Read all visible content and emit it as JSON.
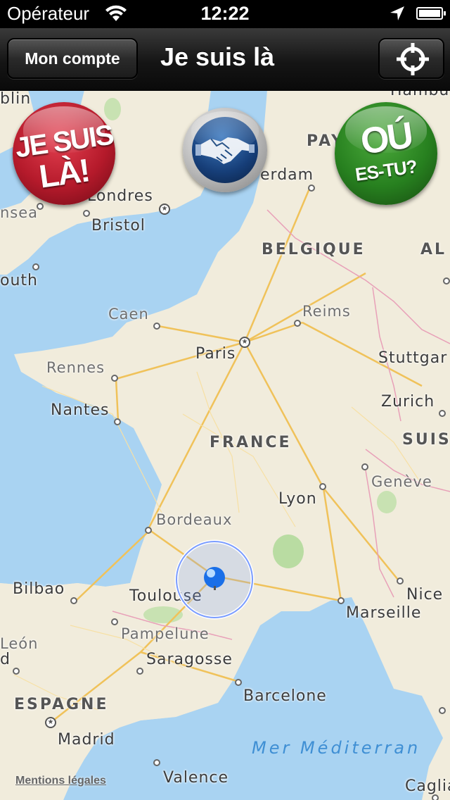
{
  "status_bar": {
    "carrier": "Opérateur",
    "time": "12:22",
    "icons": [
      "wifi-icon",
      "location-arrow-icon",
      "battery-icon"
    ]
  },
  "nav": {
    "account_label": "Mon compte",
    "title": "Je suis là",
    "locate_icon": "crosshair-icon"
  },
  "buttons": {
    "je_suis_la": {
      "line1": "JE SUIS",
      "line2": "LÀ!",
      "color": "#b51a2b"
    },
    "handshake": {
      "icon": "handshake-icon",
      "color": "#163e78"
    },
    "ou_es_tu": {
      "line1": "OÚ",
      "line2": "ES-TU?",
      "color": "#27801f"
    }
  },
  "map": {
    "land_color": "#f1ecdc",
    "water_color": "#a9d3f2",
    "road_color": "#f0c25a",
    "labels": {
      "dublin": "blin",
      "pays": "PAY",
      "londres": "Londres",
      "bristol": "Bristol",
      "msea": "nsea",
      "amsterdam": "erdam",
      "belgique": "BELGIQUE",
      "al": "AL",
      "south": "outh",
      "caen": "Caen",
      "reims": "Reims",
      "paris": "Paris",
      "stuttgart": "Stuttgar",
      "rennes": "Rennes",
      "zurich": "Zurich",
      "nantes": "Nantes",
      "france": "FRANCE",
      "suis": "SUIS",
      "geneve": "Genève",
      "lyon": "Lyon",
      "bordeaux": "Bordeaux",
      "bilbao": "Bilbao",
      "toulouse": "Toulouse",
      "nice": "Nice",
      "marseille": "Marseille",
      "leon": "León",
      "d": "d",
      "pampelune": "Pampelune",
      "saragosse": "Saragosse",
      "espagne": "ESPAGNE",
      "barcelone": "Barcelone",
      "madrid": "Madrid",
      "mer": "Mer Méditerran",
      "valence": "Valence",
      "cagliari": "Cagliar",
      "hamburg": "Hambu"
    },
    "legal": "Mentions légales"
  }
}
